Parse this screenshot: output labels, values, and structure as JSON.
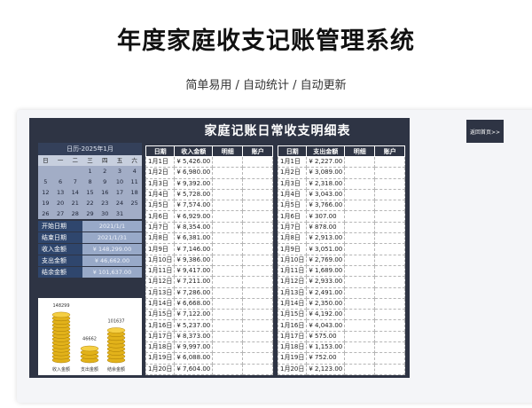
{
  "page": {
    "title": "年度家庭收支记账管理系统",
    "subtitle": "简单易用 / 自动统计 / 自动更新"
  },
  "sheet": {
    "title": "家庭记账日常收支明细表",
    "back_button": "返回首页>>"
  },
  "calendar": {
    "header": "日历-2025年1月",
    "weekdays": [
      "日",
      "一",
      "二",
      "三",
      "四",
      "五",
      "六"
    ],
    "weeks": [
      [
        "",
        "",
        "",
        "1",
        "2",
        "3",
        "4"
      ],
      [
        "5",
        "6",
        "7",
        "8",
        "9",
        "10",
        "11"
      ],
      [
        "12",
        "13",
        "14",
        "15",
        "16",
        "17",
        "18"
      ],
      [
        "19",
        "20",
        "21",
        "22",
        "23",
        "24",
        "25"
      ],
      [
        "26",
        "27",
        "28",
        "29",
        "30",
        "31",
        ""
      ]
    ]
  },
  "summary": [
    {
      "label": "开始日期",
      "value": "2021/1/1"
    },
    {
      "label": "结束日期",
      "value": "2021/1/31"
    },
    {
      "label": "收入金额",
      "value": "¥ 148,299.00"
    },
    {
      "label": "支出金额",
      "value": "¥ 46,662.00"
    },
    {
      "label": "结余金额",
      "value": "¥ 101,637.00"
    }
  ],
  "mini_chart": {
    "bars": [
      {
        "label": "收入金额",
        "value": 148299,
        "value_text": "148299"
      },
      {
        "label": "支出金额",
        "value": 46662,
        "value_text": "46662"
      },
      {
        "label": "结余金额",
        "value": 101637,
        "value_text": "101637"
      }
    ]
  },
  "income_table": {
    "headers": [
      "日期",
      "收入金额",
      "明细",
      "账户"
    ],
    "rows": [
      [
        "1月1日",
        "¥ 5,426.00"
      ],
      [
        "1月2日",
        "¥ 6,980.00"
      ],
      [
        "1月3日",
        "¥ 9,392.00"
      ],
      [
        "1月4日",
        "¥ 5,728.00"
      ],
      [
        "1月5日",
        "¥ 7,574.00"
      ],
      [
        "1月6日",
        "¥ 6,929.00"
      ],
      [
        "1月7日",
        "¥ 8,354.00"
      ],
      [
        "1月8日",
        "¥ 6,381.00"
      ],
      [
        "1月9日",
        "¥ 7,146.00"
      ],
      [
        "1月10日",
        "¥ 9,386.00"
      ],
      [
        "1月11日",
        "¥ 9,417.00"
      ],
      [
        "1月12日",
        "¥ 7,211.00"
      ],
      [
        "1月13日",
        "¥ 7,286.00"
      ],
      [
        "1月14日",
        "¥ 6,668.00"
      ],
      [
        "1月15日",
        "¥ 7,122.00"
      ],
      [
        "1月16日",
        "¥ 5,237.00"
      ],
      [
        "1月17日",
        "¥ 8,373.00"
      ],
      [
        "1月18日",
        "¥ 9,997.00"
      ],
      [
        "1月19日",
        "¥ 6,088.00"
      ],
      [
        "1月20日",
        "¥ 7,604.00"
      ]
    ]
  },
  "expense_table": {
    "headers": [
      "日期",
      "支出金额",
      "明细",
      "账户"
    ],
    "rows": [
      [
        "1月1日",
        "¥ 2,227.00"
      ],
      [
        "1月2日",
        "¥ 3,089.00"
      ],
      [
        "1月3日",
        "¥ 2,318.00"
      ],
      [
        "1月4日",
        "¥ 3,043.00"
      ],
      [
        "1月5日",
        "¥ 3,766.00"
      ],
      [
        "1月6日",
        "¥ 307.00"
      ],
      [
        "1月7日",
        "¥ 878.00"
      ],
      [
        "1月8日",
        "¥ 2,913.00"
      ],
      [
        "1月9日",
        "¥ 3,051.00"
      ],
      [
        "1月10日",
        "¥ 2,769.00"
      ],
      [
        "1月11日",
        "¥ 1,689.00"
      ],
      [
        "1月12日",
        "¥ 2,933.00"
      ],
      [
        "1月13日",
        "¥ 2,491.00"
      ],
      [
        "1月14日",
        "¥ 2,350.00"
      ],
      [
        "1月15日",
        "¥ 4,192.00"
      ],
      [
        "1月16日",
        "¥ 4,043.00"
      ],
      [
        "1月17日",
        "¥ 575.00"
      ],
      [
        "1月18日",
        "¥ 1,153.00"
      ],
      [
        "1月19日",
        "¥ 752.00"
      ],
      [
        "1月20日",
        "¥ 2,123.00"
      ]
    ]
  }
}
